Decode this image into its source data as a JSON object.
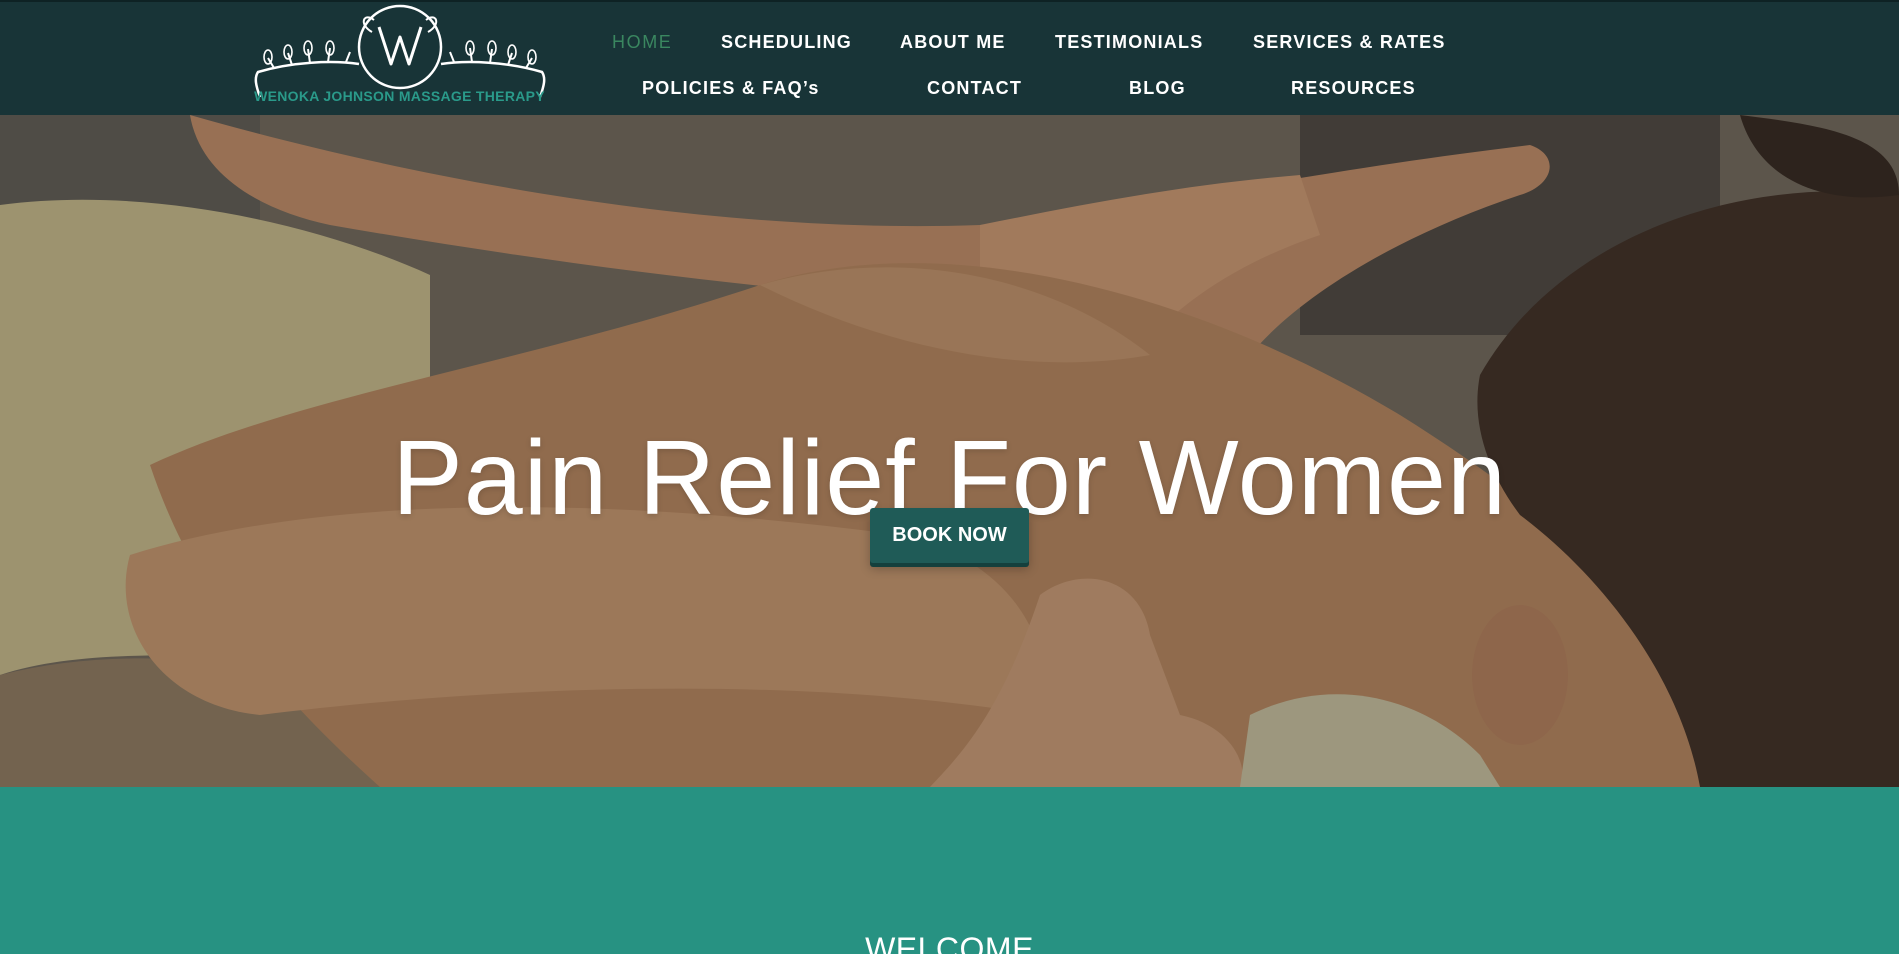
{
  "colors": {
    "header_bg": "#183437",
    "nav_active": "#3a8760",
    "nav_text": "#ffffff",
    "logo_text": "#2a9a8a",
    "button_bg": "#1f5b57",
    "welcome_bg": "#279282"
  },
  "logo": {
    "monogram": "W",
    "name": "WENOKA JOHNSON MASSAGE THERAPY"
  },
  "nav": {
    "home": "HOME",
    "scheduling": "SCHEDULING",
    "about_me": "ABOUT ME",
    "testimonials": "TESTIMONIALS",
    "services_rates": "SERVICES & RATES",
    "policies_faqs": "POLICIES & FAQ’s",
    "contact": "CONTACT",
    "blog": "BLOG",
    "resources": "RESOURCES",
    "active_item": "HOME"
  },
  "hero": {
    "image": "massage-therapy-photo",
    "title": "Pain Relief For Women",
    "button_label": "BOOK NOW"
  },
  "welcome": {
    "title": "WELCOME"
  }
}
